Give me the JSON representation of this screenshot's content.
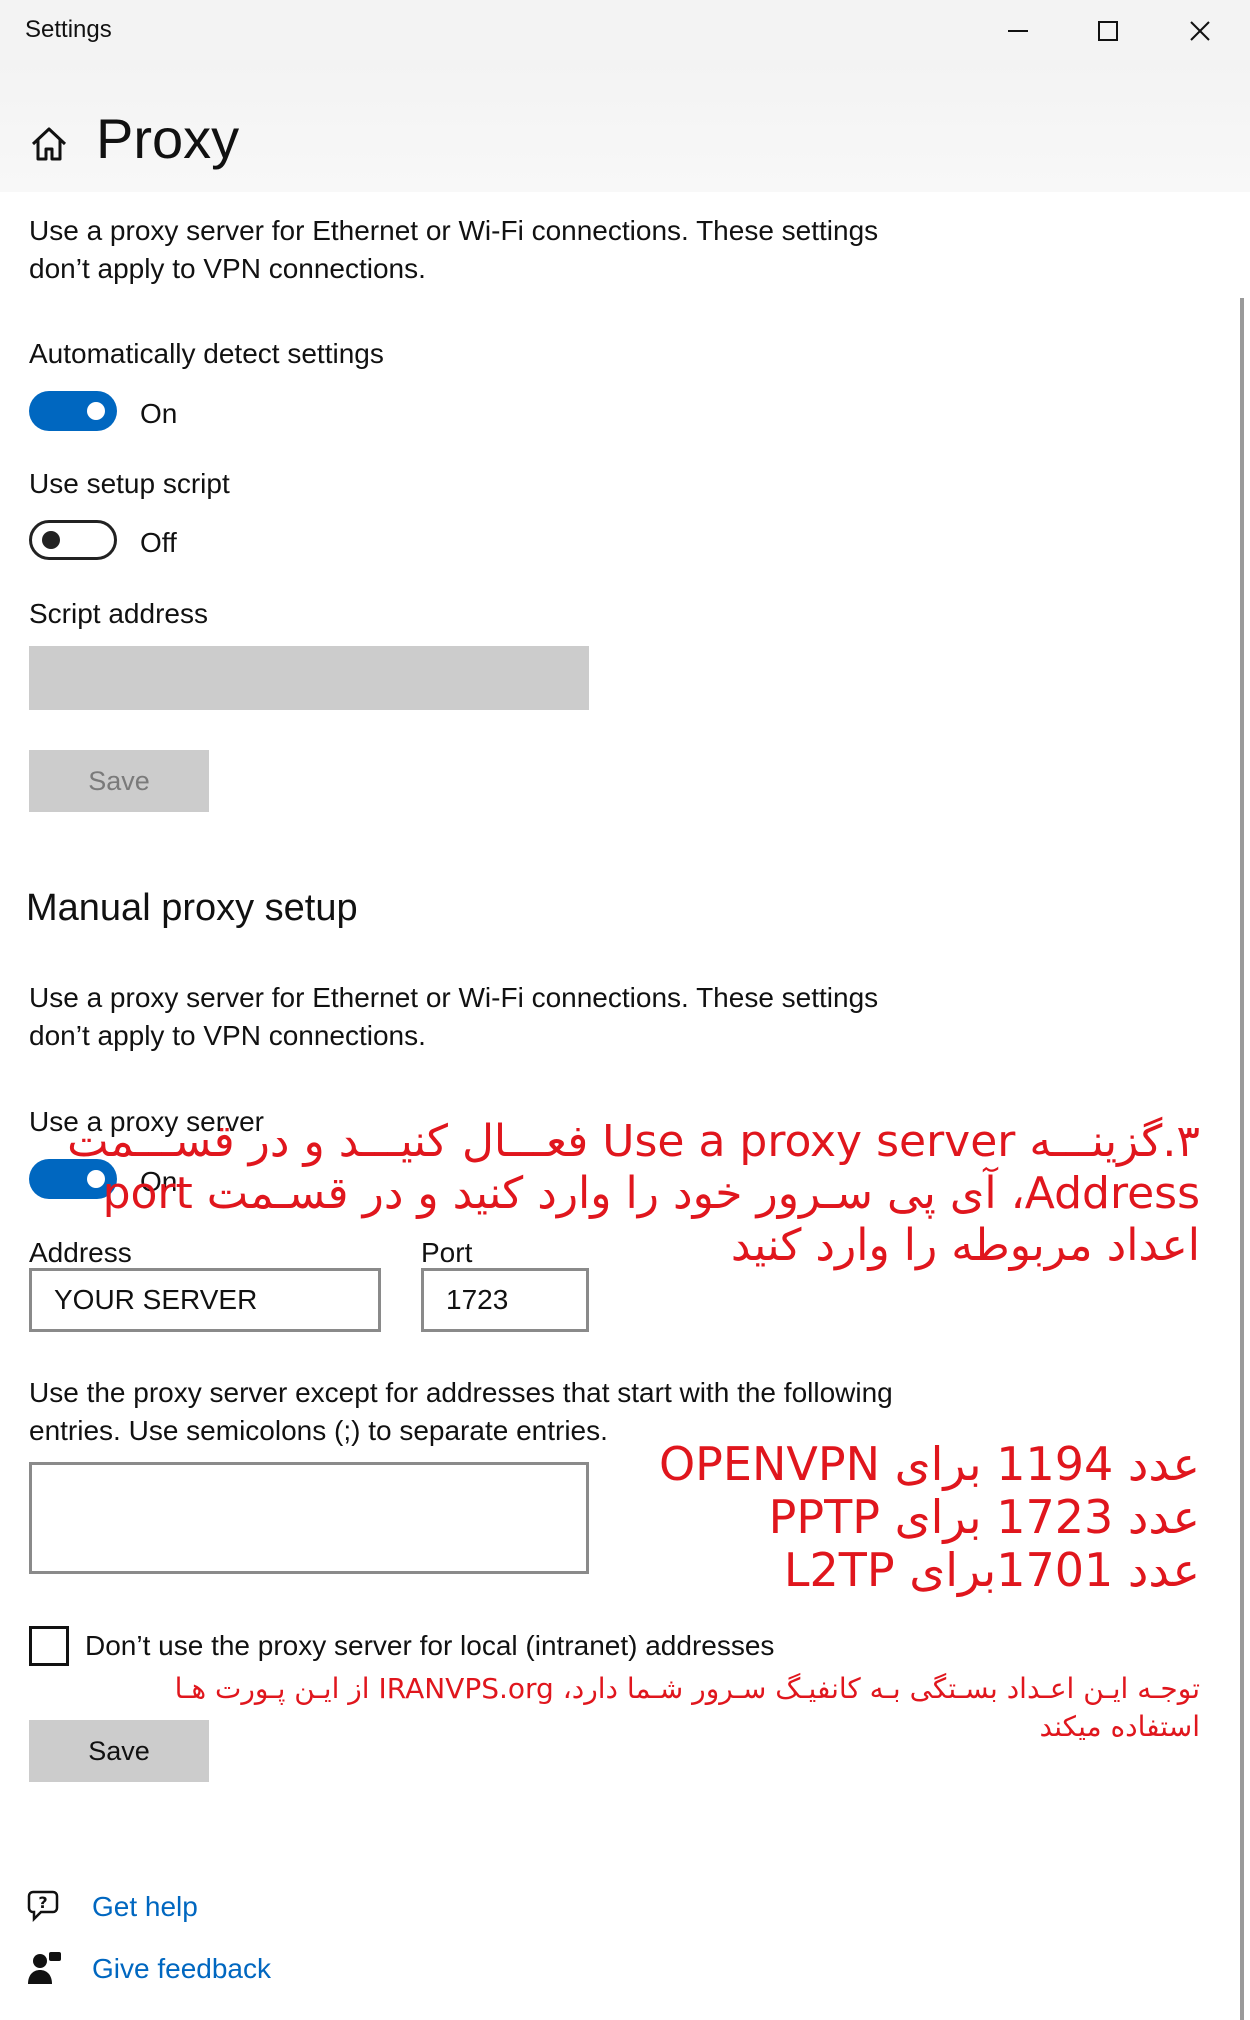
{
  "window": {
    "title": "Settings",
    "controls": {
      "minimize": "minimize-icon",
      "maximize": "maximize-icon",
      "close": "close-icon"
    }
  },
  "page": {
    "title": "Proxy",
    "home_icon": "home-icon"
  },
  "automatic": {
    "description": "Use a proxy server for Ethernet or Wi-Fi connections. These settings don’t apply to VPN connections.",
    "detect_label": "Automatically detect settings",
    "detect_state": "On",
    "script_label": "Use setup script",
    "script_state": "Off",
    "script_address_label": "Script address",
    "script_address_value": "",
    "save_label": "Save"
  },
  "manual": {
    "title": "Manual proxy setup",
    "description": "Use a proxy server for Ethernet or Wi-Fi connections. These settings don’t apply to VPN connections.",
    "use_proxy_label": "Use a proxy server",
    "use_proxy_state": "On",
    "address_label": "Address",
    "address_value": "YOUR SERVER",
    "port_label": "Port",
    "port_value": "1723",
    "exceptions_label": "Use the proxy server except for addresses that start with the following entries. Use semicolons (;) to separate entries.",
    "exceptions_value": "",
    "local_checkbox_label": "Don’t use the proxy server for local (intranet) addresses",
    "local_checkbox_checked": false,
    "save_label": "Save"
  },
  "annotations": {
    "step3_line1": "۳.گزینـــه Use a proxy server فعـــال کنیـــد و در قســـمت",
    "step3_line2": "Address، آی پی سـرور خود را وارد کنید و در قسـمت port",
    "step3_line3": "اعداد مربوطه را وارد کنید",
    "ports_line1": "عدد 1194 برای OPENVPN",
    "ports_line2": "عدد 1723 برای PPTP",
    "ports_line3": "عدد 1701برای L2TP",
    "note_line1": "توجـه ایـن اعـداد بسـتگی بـه کانفیـگ سـرور شـما دارد، IRANVPS.org  از ایـن پـورت هـا",
    "note_line2": "استفاده میکند",
    "color": "#e0161d"
  },
  "footer": {
    "get_help_label": "Get help",
    "get_help_icon": "help-chat-icon",
    "give_feedback_label": "Give feedback",
    "give_feedback_icon": "feedback-person-icon"
  },
  "colors": {
    "accent": "#0067c0",
    "disabled": "#cccccc",
    "titlebar": "#f3f3f3"
  }
}
